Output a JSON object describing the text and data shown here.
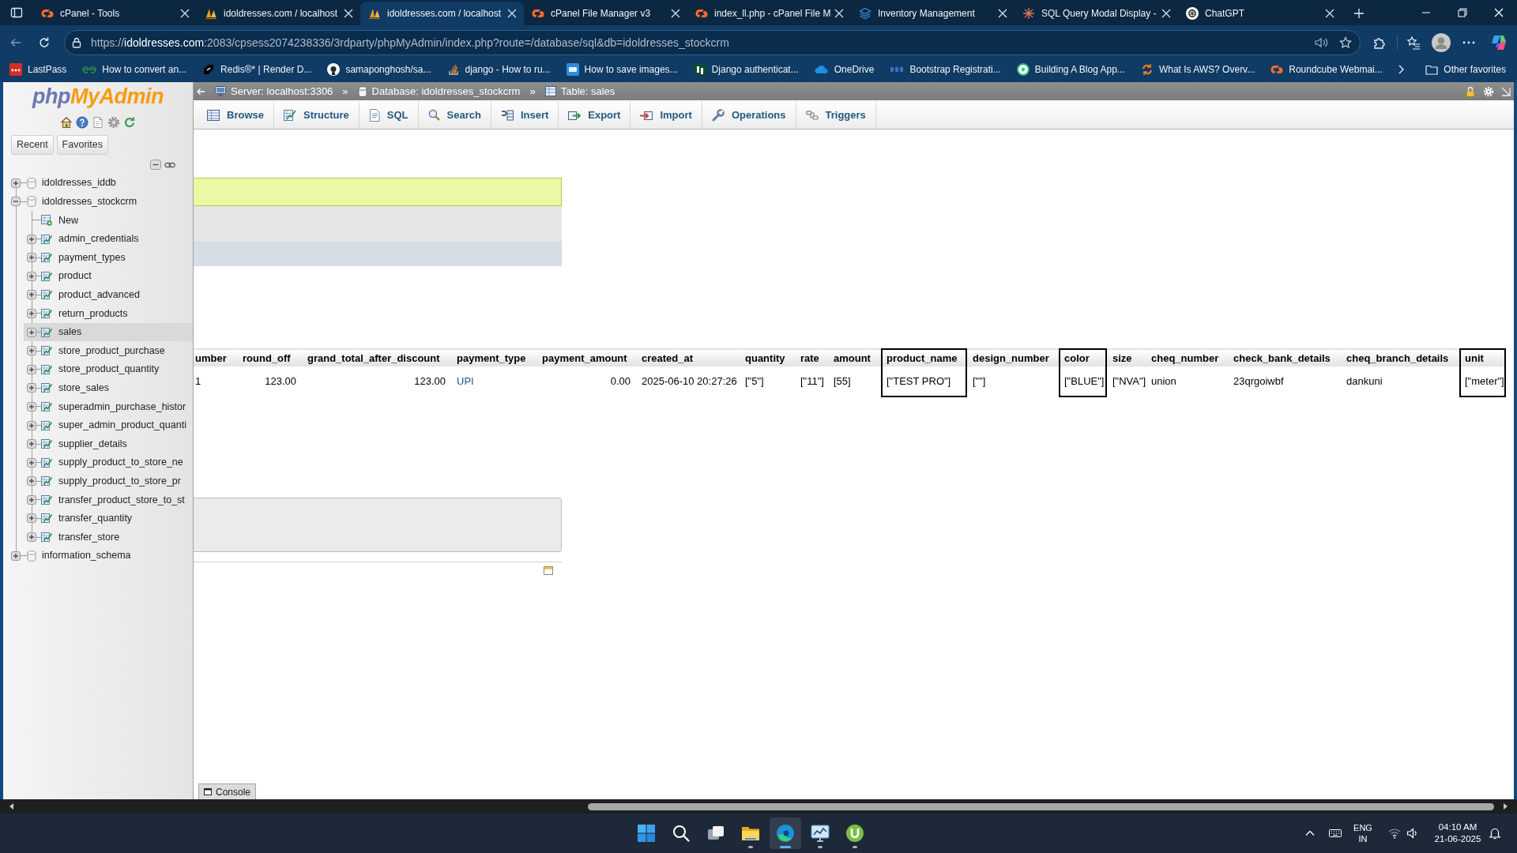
{
  "browser": {
    "tabs": [
      {
        "title": "cPanel - Tools",
        "selected": false
      },
      {
        "title": "idoldresses.com / localhost",
        "selected": false
      },
      {
        "title": "idoldresses.com / localhost",
        "selected": true
      },
      {
        "title": "cPanel File Manager v3",
        "selected": false
      },
      {
        "title": "index_ll.php - cPanel File M",
        "selected": false
      },
      {
        "title": "Inventory Management",
        "selected": false
      },
      {
        "title": "SQL Query Modal Display -",
        "selected": false
      },
      {
        "title": "ChatGPT",
        "selected": false
      }
    ],
    "address": {
      "scheme": "https://",
      "host": "idoldresses.com",
      "path": ":2083/cpsess2074238336/3rdparty/phpMyAdmin/index.php?route=/database/sql&db=idoldresses_stockcrm"
    },
    "bookmarks": [
      "LastPass",
      "How to convert an...",
      "Redis®* | Render D...",
      "samaponghosh/sa...",
      "django - How to ru...",
      "How to save images...",
      "Django authenticat...",
      "OneDrive",
      "Bootstrap Registrati...",
      "Building A Blog App...",
      "What Is AWS? Overv...",
      "Roundcube Webmai..."
    ],
    "other_favorites": "Other favorites"
  },
  "sidebar": {
    "logo": {
      "part_1": "php",
      "part_2": "MyAdmin"
    },
    "buttons": [
      "Recent",
      "Favorites"
    ],
    "tree": [
      {
        "label": "idoldresses_iddb",
        "kind": "database",
        "expanded": false,
        "selected": false
      },
      {
        "label": "idoldresses_stockcrm",
        "kind": "database",
        "expanded": true,
        "selected": false,
        "children": [
          {
            "label": "New",
            "kind": "new",
            "selected": false
          },
          {
            "label": "admin_credentials",
            "kind": "table",
            "expanded": false,
            "selected": false
          },
          {
            "label": "payment_types",
            "kind": "table",
            "expanded": false,
            "selected": false
          },
          {
            "label": "product",
            "kind": "table",
            "expanded": false,
            "selected": false
          },
          {
            "label": "product_advanced",
            "kind": "table",
            "expanded": false,
            "selected": false
          },
          {
            "label": "return_products",
            "kind": "table",
            "expanded": false,
            "selected": false
          },
          {
            "label": "sales",
            "kind": "table",
            "expanded": false,
            "selected": true
          },
          {
            "label": "store_product_purchase",
            "kind": "table",
            "expanded": false,
            "selected": false
          },
          {
            "label": "store_product_quantity",
            "kind": "table",
            "expanded": false,
            "selected": false
          },
          {
            "label": "store_sales",
            "kind": "table",
            "expanded": false,
            "selected": false
          },
          {
            "label": "superadmin_purchase_histor",
            "kind": "table",
            "expanded": false,
            "selected": false
          },
          {
            "label": "super_admin_product_quanti",
            "kind": "table",
            "expanded": false,
            "selected": false
          },
          {
            "label": "supplier_details",
            "kind": "table",
            "expanded": false,
            "selected": false
          },
          {
            "label": "supply_product_to_store_ne",
            "kind": "table",
            "expanded": false,
            "selected": false
          },
          {
            "label": "supply_product_to_store_pr",
            "kind": "table",
            "expanded": false,
            "selected": false
          },
          {
            "label": "transfer_product_store_to_st",
            "kind": "table",
            "expanded": false,
            "selected": false
          },
          {
            "label": "transfer_quantity",
            "kind": "table",
            "expanded": false,
            "selected": false
          },
          {
            "label": "transfer_store",
            "kind": "table",
            "expanded": false,
            "selected": false
          }
        ]
      },
      {
        "label": "information_schema",
        "kind": "database",
        "expanded": false,
        "selected": false
      }
    ]
  },
  "pma": {
    "breadcrumb": [
      "Server: localhost:3306",
      "Database: idoldresses_stockcrm",
      "Table: sales"
    ],
    "breadcrumb_separators": [
      "»",
      "»"
    ],
    "tabs": [
      "Browse",
      "Structure",
      "SQL",
      "Search",
      "Insert",
      "Export",
      "Import",
      "Operations",
      "Triggers"
    ],
    "results": {
      "columns": [
        {
          "label": "umber",
          "kind": "text",
          "outlined": false
        },
        {
          "label": "round_off",
          "kind": "number",
          "outlined": false
        },
        {
          "label": "grand_total_after_discount",
          "kind": "number",
          "outlined": false
        },
        {
          "label": "payment_type",
          "kind": "link",
          "outlined": false
        },
        {
          "label": "payment_amount",
          "kind": "number",
          "outlined": false
        },
        {
          "label": "created_at",
          "kind": "text",
          "outlined": false
        },
        {
          "label": "quantity",
          "kind": "text",
          "outlined": false
        },
        {
          "label": "rate",
          "kind": "text",
          "outlined": false
        },
        {
          "label": "amount",
          "kind": "text",
          "outlined": false
        },
        {
          "label": "product_name",
          "kind": "text",
          "outlined": true
        },
        {
          "label": "design_number",
          "kind": "text",
          "outlined": false
        },
        {
          "label": "color",
          "kind": "text",
          "outlined": true
        },
        {
          "label": "size",
          "kind": "text",
          "outlined": false
        },
        {
          "label": "cheq_number",
          "kind": "text",
          "outlined": false
        },
        {
          "label": "check_bank_details",
          "kind": "text",
          "outlined": false
        },
        {
          "label": "cheq_branch_details",
          "kind": "text",
          "outlined": false
        },
        {
          "label": "unit",
          "kind": "text",
          "outlined": true
        }
      ],
      "rows": [
        [
          "1",
          "123.00",
          "123.00",
          "UPI",
          "0.00",
          "2025-06-10 20:27:26",
          "[\"5\"]",
          "[\"11\"]",
          "[55]",
          "[\"TEST PRO\"]",
          "[\"\"]",
          "[\"BLUE\"]",
          "[\"NVA\"]",
          "union",
          "23qrgoiwbf",
          "dankuni",
          "[\"meter\"]"
        ]
      ]
    },
    "console": "Console"
  },
  "taskbar": {
    "apps": [
      {
        "running": false,
        "selected": false
      },
      {
        "running": false,
        "selected": false
      },
      {
        "running": false,
        "selected": false
      },
      {
        "running": true,
        "selected": false
      },
      {
        "running": true,
        "selected": true
      },
      {
        "running": true,
        "selected": false
      },
      {
        "running": true,
        "selected": false
      }
    ],
    "language": "ENG",
    "region": "IN",
    "time": "04:10 AM",
    "date": "21-06-2025"
  }
}
